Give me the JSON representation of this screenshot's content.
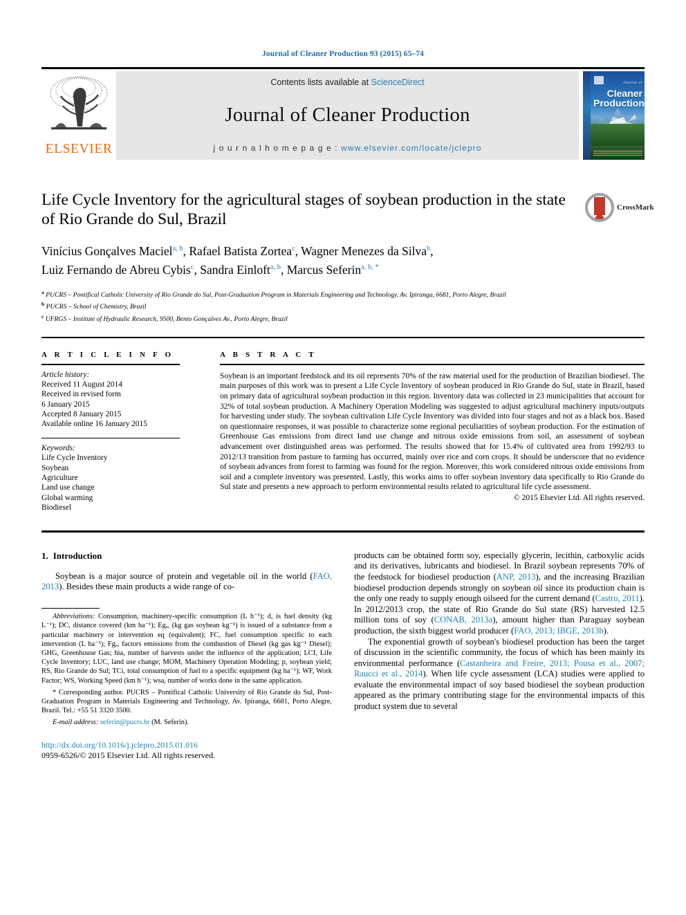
{
  "running_head": "Journal of Cleaner Production 93 (2015) 65–74",
  "banner": {
    "publisher": "ELSEVIER",
    "contents_prefix": "Contents lists available at ",
    "contents_link": "ScienceDirect",
    "journal_title": "Journal of Cleaner Production",
    "homepage_prefix": "j o u r n a l   h o m e p a g e :  ",
    "homepage_url": "www.elsevier.com/locate/jclepro",
    "cover_sup": "Journal of",
    "cover_title_line1": "Cleaner",
    "cover_title_line2": "Production"
  },
  "crossmark": {
    "label": "CrossMark"
  },
  "article": {
    "title": "Life Cycle Inventory for the agricultural stages of soybean production in the state of Rio Grande do Sul, Brazil",
    "authors_line1": "Vinícius Gonçalves Maciel",
    "authors_line1_sup": "a, b",
    "author2": "Rafael Batista Zortea",
    "author2_sup": "c",
    "author3": "Wagner Menezes da Silva",
    "author3_sup": "b",
    "author4": "Luiz Fernando de Abreu Cybis",
    "author4_sup": "c",
    "author5": "Sandra Einloft",
    "author5_sup": "a, b",
    "author6": "Marcus Seferin",
    "author6_sup": "a, b, *",
    "affiliations": [
      {
        "mark": "a",
        "text": "PUCRS – Pontifical Catholic University of Rio Grande do Sul, Post-Graduation Program in Materials Engineering and Technology, Av. Ipiranga, 6681, Porto Alegre, Brazil"
      },
      {
        "mark": "b",
        "text": "PUCRS – School of Chemistry, Brazil"
      },
      {
        "mark": "c",
        "text": "UFRGS – Institute of Hydraulic Research, 9500, Bento Gonçalves Av., Porto Alegre, Brazil"
      }
    ]
  },
  "article_info": {
    "heading": "A R T I C L E   I N F O",
    "history_label": "Article history:",
    "history": [
      "Received 11 August 2014",
      "Received in revised form",
      "6 January 2015",
      "Accepted 8 January 2015",
      "Available online 16 January 2015"
    ],
    "keywords_label": "Keywords:",
    "keywords": [
      "Life Cycle Inventory",
      "Soybean",
      "Agriculture",
      "Land use change",
      "Global warming",
      "Biodiesel"
    ]
  },
  "abstract": {
    "heading": "A B S T R A C T",
    "text": "Soybean is an important feedstock and its oil represents 70% of the raw material used for the production of Brazilian biodiesel. The main purposes of this work was to present a Life Cycle Inventory of soybean produced in Rio Grande do Sul, state in Brazil, based on primary data of agricultural soybean production in this region. Inventory data was collected in 23 municipalities that account for 32% of total soybean production. A Machinery Operation Modeling was suggested to adjust agricultural machinery inputs/outputs for harvesting under study. The soybean cultivation Life Cycle Inventory was divided into four stages and not as a black box. Based on questionnaire responses, it was possible to characterize some regional peculiarities of soybean production. For the estimation of Greenhouse Gas emissions from direct land use change and nitrous oxide emissions from soil, an assessment of soybean advancement over distinguished areas was performed. The results showed that for 15.4% of cultivated area from 1992/93 to 2012/13 transition from pasture to farming has occurred, mainly over rice and corn crops. It should be underscore that no evidence of soybean advances from forest to farming was found for the region. Moreover, this work considered nitrous oxide emissions from soil and a complete inventory was presented. Lastly, this works aims to offer soybean inventory data specifically to Rio Grande do Sul state and presents a new approach to perform environmental results related to agricultural life cycle assessment.",
    "copyright": "© 2015 Elsevier Ltd. All rights reserved."
  },
  "introduction": {
    "number": "1.",
    "title": "Introduction",
    "para1_a": "Soybean is a major source of protein and vegetable oil in the world (",
    "para1_ref": "FAO, 2013",
    "para1_b": "). Besides these main products a wide range of co-"
  },
  "right_column": {
    "cont_a": "products can be obtained form soy, especially glycerin, lecithin, carboxylic acids and its derivatives, lubricants and biodiesel. In Brazil soybean represents 70% of the feedstock for biodiesel production (",
    "ref1": "ANP, 2013",
    "cont_b": "), and the increasing Brazilian biodiesel production depends strongly on soybean oil since its production chain is the only one ready to supply enough oilseed for the current demand (",
    "ref2": "Castro, 2011",
    "cont_c": "). In 2012/2013 crop, the state of Rio Grande do Sul state (RS) harvested 12.5 million tons of soy (",
    "ref3": "CONAB, 2013a",
    "cont_d": "), amount higher than Paraguay soybean production, the sixth biggest world producer (",
    "ref4": "FAO, 2013; IBGE, 2013b",
    "cont_e": ").",
    "para2_a": "The exponential growth of soybean's biodiesel production has been the target of discussion in the scientific community, the focus of which has been mainly its environmental performance (",
    "para2_ref": "Castanheira and Freire, 2013; Pousa et al., 2007; Raucci et al., 2014",
    "para2_b": "). When life cycle assessment (LCA) studies were applied to evaluate the environmental impact of soy based biodiesel the soybean production appeared as the primary contributing stage for the environmental impacts of this product system due to several"
  },
  "footnotes": {
    "abbrev_label": "Abbreviations:",
    "abbrev_text": " Consumption, machinery-specific consumption (L h⁻¹); d, is fuel density (kg L⁻¹); DC, distance covered (km ha⁻¹); Egₐ, (kg gas soybean kg⁻¹) is issued of a substance from a particular machinery or intervention eq (equivalent); FC, fuel consumption specific to each intervention (L ha⁻¹); Fgₐ, factors emissions from the combustion of Diesel (kg gas kg⁻¹ Diesel); GHG, Greenhouse Gas; hia, number of harvests under the influence of the application; LCI, Life Cycle Inventory; LUC, land use change; MOM, Machinery Operation Modeling; p, soybean yield; RS, Rio Grande do Sul; TCi, total consumption of fuel to a specific equipment (kg ha⁻¹); WF, Work Factor; WS, Working Speed (km h⁻¹); wsa, number of works done in the same application.",
    "corresponding_star": "*",
    "corresponding_text": " Corresponding author. PUCRS – Pontifical Catholic University of Rio Grande do Sul, Post-Graduation Program in Materials Engineering and Technology, Av. Ipiranga, 6681, Porto Alegre, Brazil. Tel.: +55 51 3320 3500.",
    "email_label": "E-mail address:",
    "email": "seferin@pucrs.br",
    "email_suffix": " (M. Seferin)."
  },
  "footer": {
    "doi": "http://dx.doi.org/10.1016/j.jclepro.2015.01.016",
    "issn": "0959-6526/© 2015 Elsevier Ltd. All rights reserved."
  },
  "colors": {
    "link_blue": "#1b7fb5",
    "header_blue": "#1b6ba8",
    "elsevier_orange": "#eb6b09",
    "banner_grey": "#e6e6e6",
    "crossmark_red": "#c0392b"
  }
}
